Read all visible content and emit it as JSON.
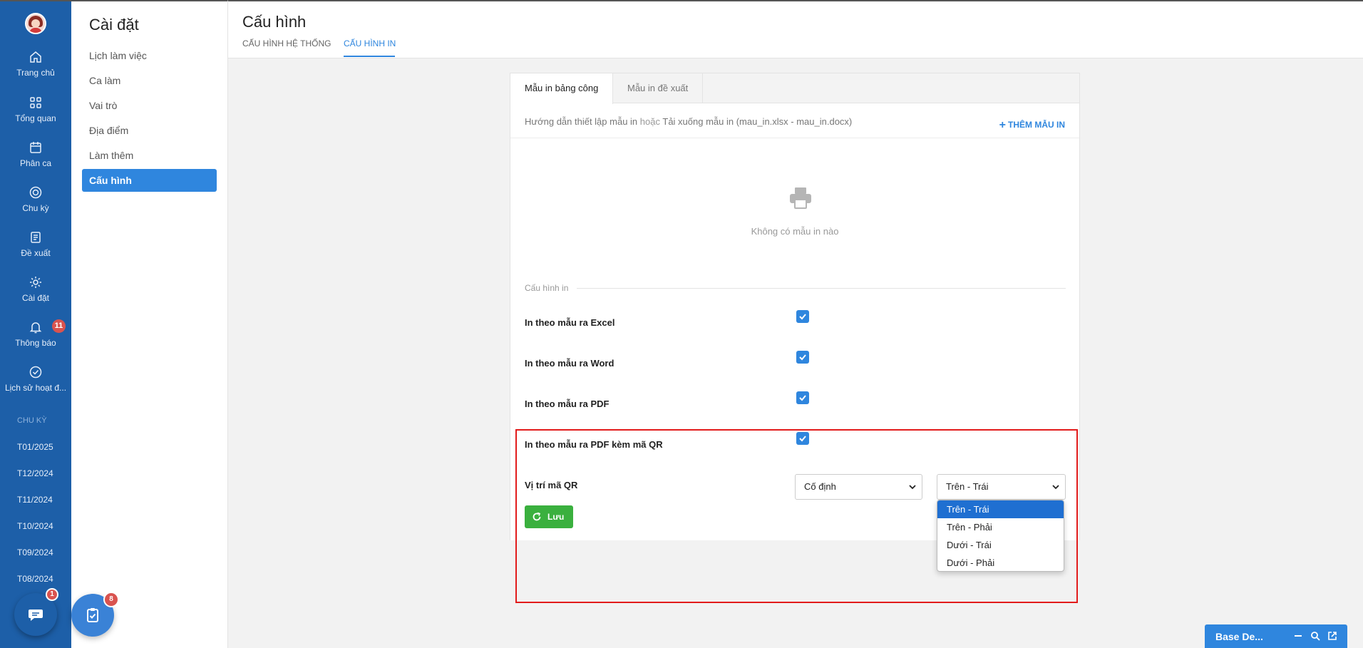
{
  "nav": {
    "items": [
      {
        "label": "Trang chủ",
        "icon": "home-icon"
      },
      {
        "label": "Tổng quan",
        "icon": "grid-icon"
      },
      {
        "label": "Phân ca",
        "icon": "calendar-icon"
      },
      {
        "label": "Chu kỳ",
        "icon": "target-icon"
      },
      {
        "label": "Đề xuất",
        "icon": "document-icon"
      },
      {
        "label": "Cài đặt",
        "icon": "gear-icon"
      },
      {
        "label": "Thông báo",
        "icon": "bell-icon"
      },
      {
        "label": "Lịch sử hoạt đ...",
        "icon": "check-circle-icon"
      }
    ],
    "notification_badge": "11",
    "section_label": "CHU KỲ",
    "periods": [
      "T01/2025",
      "T12/2024",
      "T11/2024",
      "T10/2024",
      "T09/2024",
      "T08/2024"
    ]
  },
  "fabs": {
    "chat_badge": "1",
    "task_badge": "8"
  },
  "sidebar": {
    "title": "Cài đặt",
    "items": [
      {
        "label": "Lịch làm việc"
      },
      {
        "label": "Ca làm"
      },
      {
        "label": "Vai trò"
      },
      {
        "label": "Địa điểm"
      },
      {
        "label": "Làm thêm"
      },
      {
        "label": "Cấu hình",
        "active": true
      }
    ]
  },
  "header": {
    "title": "Cấu hình",
    "tabs": [
      {
        "label": "CẤU HÌNH HỆ THỐNG"
      },
      {
        "label": "CẤU HÌNH IN",
        "active": true
      }
    ]
  },
  "card": {
    "tabs": [
      {
        "label": "Mẫu in bảng công",
        "active": true
      },
      {
        "label": "Mẫu in đề xuất"
      }
    ],
    "guide_link": "Hướng dẫn thiết lập mẫu in",
    "guide_or": "hoặc",
    "guide_download": "Tải xuống mẫu in (mau_in.xlsx - mau_in.docx)",
    "add_button": "THÊM MẪU IN",
    "empty_text": "Không có mẫu in nào",
    "section_title": "Cấu hình in",
    "options": [
      {
        "label": "In theo mẫu ra Excel",
        "checked": true
      },
      {
        "label": "In theo mẫu ra Word",
        "checked": true
      },
      {
        "label": "In theo mẫu ra PDF",
        "checked": true
      },
      {
        "label": "In theo mẫu ra PDF kèm mã QR",
        "checked": true
      }
    ],
    "qr_label": "Vị trí mã QR",
    "qr_mode": "Cố định",
    "qr_position": "Trên - Trái",
    "qr_position_options": [
      "Trên - Trái",
      "Trên - Phải",
      "Dưới - Trái",
      "Dưới - Phải"
    ],
    "save_button": "Lưu"
  },
  "chatbar": {
    "title": "Base De..."
  },
  "colors": {
    "nav": "#1d5fa8",
    "accent": "#2f86de",
    "save": "#3ab03e",
    "highlight": "#e21b1b"
  }
}
